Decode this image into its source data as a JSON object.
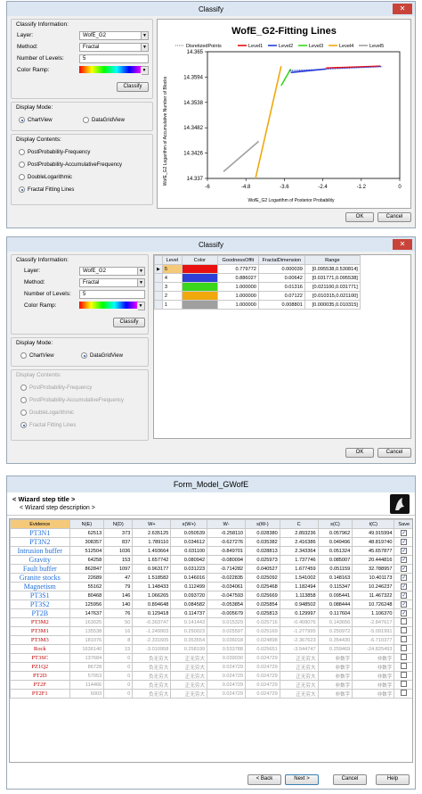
{
  "window1": {
    "title": "Classify",
    "close_glyph": "✕",
    "classify_info_label": "Classify Information:",
    "layer_label": "Layer:",
    "layer_value": "WofE_G2",
    "method_label": "Method:",
    "method_value": "Fractal",
    "levels_label": "Number of Levels:",
    "levels_value": "5",
    "ramp_label": "Color Ramp:",
    "classify_button": "Classify",
    "display_mode_label": "Display Mode:",
    "mode_chart": "ChartView",
    "mode_grid": "DataGridView",
    "display_contents_label": "Display Contents:",
    "contents": [
      "PostProbability-Frequency",
      "PostProbability-AccumulativeFrequency",
      "DoubleLogarithmic",
      "Fractal Fitting Lines"
    ],
    "ok": "OK",
    "cancel": "Cancel",
    "chart_title": "WofE_G2-Fitting Lines",
    "legend": [
      "DisretizedPoints",
      "Level1",
      "Level2",
      "Level3",
      "Level4",
      "Level5"
    ],
    "xlabel": "WofE_G2 Logarithm of Posterior Probability",
    "ylabel": "WofE_G2 Logarithm of Accumulative Number of Blocks",
    "yticks": [
      "14.365",
      "14.3594",
      "14.3538",
      "14.3482",
      "14.3426",
      "14.337"
    ],
    "xticks": [
      "-6",
      "-4.8",
      "-3.6",
      "-2.4",
      "-1.2",
      "0"
    ]
  },
  "window2": {
    "title": "Classify",
    "close_glyph": "✕",
    "classify_info_label": "Classify Information:",
    "layer_label": "Layer:",
    "layer_value": "WofE_G2",
    "method_label": "Method:",
    "method_value": "Fractal",
    "levels_label": "Number of Levels:",
    "levels_value": "5",
    "ramp_label": "Color Ramp:",
    "classify_button": "Classify",
    "display_mode_label": "Display Mode:",
    "mode_chart": "ChartView",
    "mode_grid": "DataGridView",
    "display_contents_label": "Display Contents:",
    "contents": [
      "PostProbability-Frequency",
      "PostProbability-AccumulativeFrequency",
      "DoubleLogarithmic",
      "Fractal Fitting Lines"
    ],
    "ok": "OK",
    "cancel": "Cancel",
    "grid_headers": [
      "Level",
      "Color",
      "GoodnessOffit",
      "FractalDimension",
      "Range"
    ],
    "grid_rows": [
      {
        "level": "5",
        "color": "#e81010",
        "good": "0.779772",
        "frac": "0.000039",
        "range": "[0.095538,0.530814]"
      },
      {
        "level": "4",
        "color": "#2d3fd6",
        "good": "0.886027",
        "frac": "0.00642",
        "range": "[0.031771,0.095538]"
      },
      {
        "level": "3",
        "color": "#39d61c",
        "good": "1.000000",
        "frac": "0.01316",
        "range": "[0.021100,0.031771]"
      },
      {
        "level": "2",
        "color": "#f0a80c",
        "good": "1.000000",
        "frac": "0.07122",
        "range": "[0.010315,0.021100]"
      },
      {
        "level": "1",
        "color": "#a0a0a0",
        "good": "1.000000",
        "frac": "0.008801",
        "range": "[0.000035,0.010315]"
      }
    ]
  },
  "window3": {
    "title": "Form_Model_GWofE",
    "wizard_title": "< Wizard step title >",
    "wizard_desc": "< Wizard step description >",
    "headers": [
      "Evidence",
      "N(E)",
      "N(D)",
      "W+",
      "s(W+)",
      "W-",
      "s(W-)",
      "C",
      "s(C)",
      "t(C)",
      "Save"
    ],
    "rows": [
      [
        "PT3N1",
        "62513",
        "373",
        "2.635125",
        "0.050539",
        "-0.258110",
        "0.028380",
        "2.893236",
        "0.057962",
        "49.915994",
        "1"
      ],
      [
        "PT3N2",
        "308357",
        "837",
        "1.789110",
        "0.034612",
        "-0.627276",
        "0.035382",
        "2.416386",
        "0.049496",
        "48.819740",
        "1"
      ],
      [
        "Intrusion buffer",
        "512504",
        "1036",
        "1.493664",
        "0.031100",
        "-0.849701",
        "0.028813",
        "2.343364",
        "0.051324",
        "45.657877",
        "1"
      ],
      [
        "Gravity",
        "64258",
        "153",
        "1.657742",
        "0.080942",
        "-0.080094",
        "0.025973",
        "1.737746",
        "0.085007",
        "20.444816",
        "1"
      ],
      [
        "Fault buffer",
        "862847",
        "1097",
        "0.963177",
        "0.031223",
        "-0.714282",
        "0.040527",
        "1.677459",
        "0.051159",
        "32.788957",
        "1"
      ],
      [
        "Granite stocks",
        "22689",
        "47",
        "1.518582",
        "0.146016",
        "-0.022835",
        "0.025092",
        "1.541002",
        "0.148163",
        "10.401173",
        "1"
      ],
      [
        "Magnetism",
        "55162",
        "79",
        "1.148433",
        "0.112499",
        "-0.034061",
        "0.025468",
        "1.182494",
        "0.115347",
        "10.246237",
        "1"
      ],
      [
        "PT3S1",
        "80468",
        "146",
        "1.066265",
        "0.093720",
        "-0.047593",
        "0.025669",
        "1.113858",
        "0.095441",
        "11.467322",
        "1"
      ],
      [
        "PT3S2",
        "125956",
        "140",
        "0.894648",
        "0.084582",
        "-0.053854",
        "0.025854",
        "0.948502",
        "0.088444",
        "10.726248",
        "1"
      ],
      [
        "PT2B",
        "147637",
        "76",
        "0.129418",
        "0.114737",
        "-0.005679",
        "0.025813",
        "0.129997",
        "0.117604",
        "1.106370",
        "1"
      ],
      [
        "PT3M2",
        "163025",
        "50",
        "-0.393747",
        "0.141443",
        "0.015329",
        "0.025716",
        "-0.409076",
        "0.143656",
        "-2.847617",
        "0"
      ],
      [
        "PT3M1",
        "135538",
        "16",
        "-1.249903",
        "0.250023",
        "0.025597",
        "0.025169",
        "-1.277995",
        "0.250972",
        "-5.091991",
        "0"
      ],
      [
        "PT3M3",
        "181076",
        "8",
        "-2.331605",
        "0.353554",
        "0.036018",
        "0.024898",
        "-2.367623",
        "0.354430",
        "-6.710377",
        "0"
      ],
      [
        "Rock",
        "1636140",
        "15",
        "-3.010958",
        "0.258199",
        "0.533788",
        "0.025651",
        "-3.544747",
        "0.259469",
        "-24.825493",
        "0"
      ],
      [
        "PT3SC",
        "137684",
        "0",
        "负无穷大",
        "正无穷大",
        "0.039030",
        "0.024729",
        "正无穷大",
        "非数字",
        "非数字",
        "0"
      ],
      [
        "PZ1Q2",
        "86728",
        "0",
        "负无穷大",
        "正无穷大",
        "0.024729",
        "0.024729",
        "正无穷大",
        "非数字",
        "非数字",
        "0"
      ],
      [
        "PT2D",
        "57053",
        "0",
        "负无穷大",
        "正无穷大",
        "0.024729",
        "0.024729",
        "正无穷大",
        "非数字",
        "非数字",
        "0"
      ],
      [
        "PT2F",
        "114466",
        "0",
        "负无穷大",
        "正无穷大",
        "0.024729",
        "0.024729",
        "正无穷大",
        "非数字",
        "非数字",
        "0"
      ],
      [
        "PT2F1",
        "6003",
        "0",
        "负无穷大",
        "正无穷大",
        "0.024729",
        "0.024729",
        "正无穷大",
        "非数字",
        "非数字",
        "0"
      ]
    ],
    "back": "< Back",
    "next": "Next >",
    "cancel": "Cancel",
    "help": "Help"
  },
  "colors": {
    "level1": "#e81010",
    "level2": "#2d3fd6",
    "level3": "#39d61c",
    "level4": "#f0a80c",
    "level5": "#a0a0a0",
    "window_close": "#c8443a"
  },
  "chart_data": {
    "type": "line",
    "title": "WofE_G2-Fitting Lines",
    "xlabel": "WofE_G2 Logarithm of Posterior Probability",
    "ylabel": "WofE_G2 Logarithm of Accumulative Number of Blocks",
    "xlim": [
      -6,
      0
    ],
    "ylim": [
      14.337,
      14.365
    ],
    "legend_position": "top",
    "series": [
      {
        "name": "Level1",
        "color": "#e81010",
        "x": [
          -2.3,
          -0.6
        ],
        "y": [
          14.3614,
          14.3618
        ]
      },
      {
        "name": "Level2",
        "color": "#2d3fd6",
        "x": [
          -3.4,
          -2.3
        ],
        "y": [
          14.3604,
          14.3612
        ]
      },
      {
        "name": "Level3",
        "color": "#39d61c",
        "x": [
          -3.7,
          -3.4
        ],
        "y": [
          14.3575,
          14.3612
        ]
      },
      {
        "name": "Level4",
        "color": "#f0a80c",
        "x": [
          -4.5,
          -3.7
        ],
        "y": [
          14.337,
          14.3618
        ]
      },
      {
        "name": "Level5",
        "color": "#a0a0a0",
        "x": [
          -5.5,
          -4.4
        ],
        "y": [
          14.3385,
          14.3452
        ]
      }
    ]
  }
}
